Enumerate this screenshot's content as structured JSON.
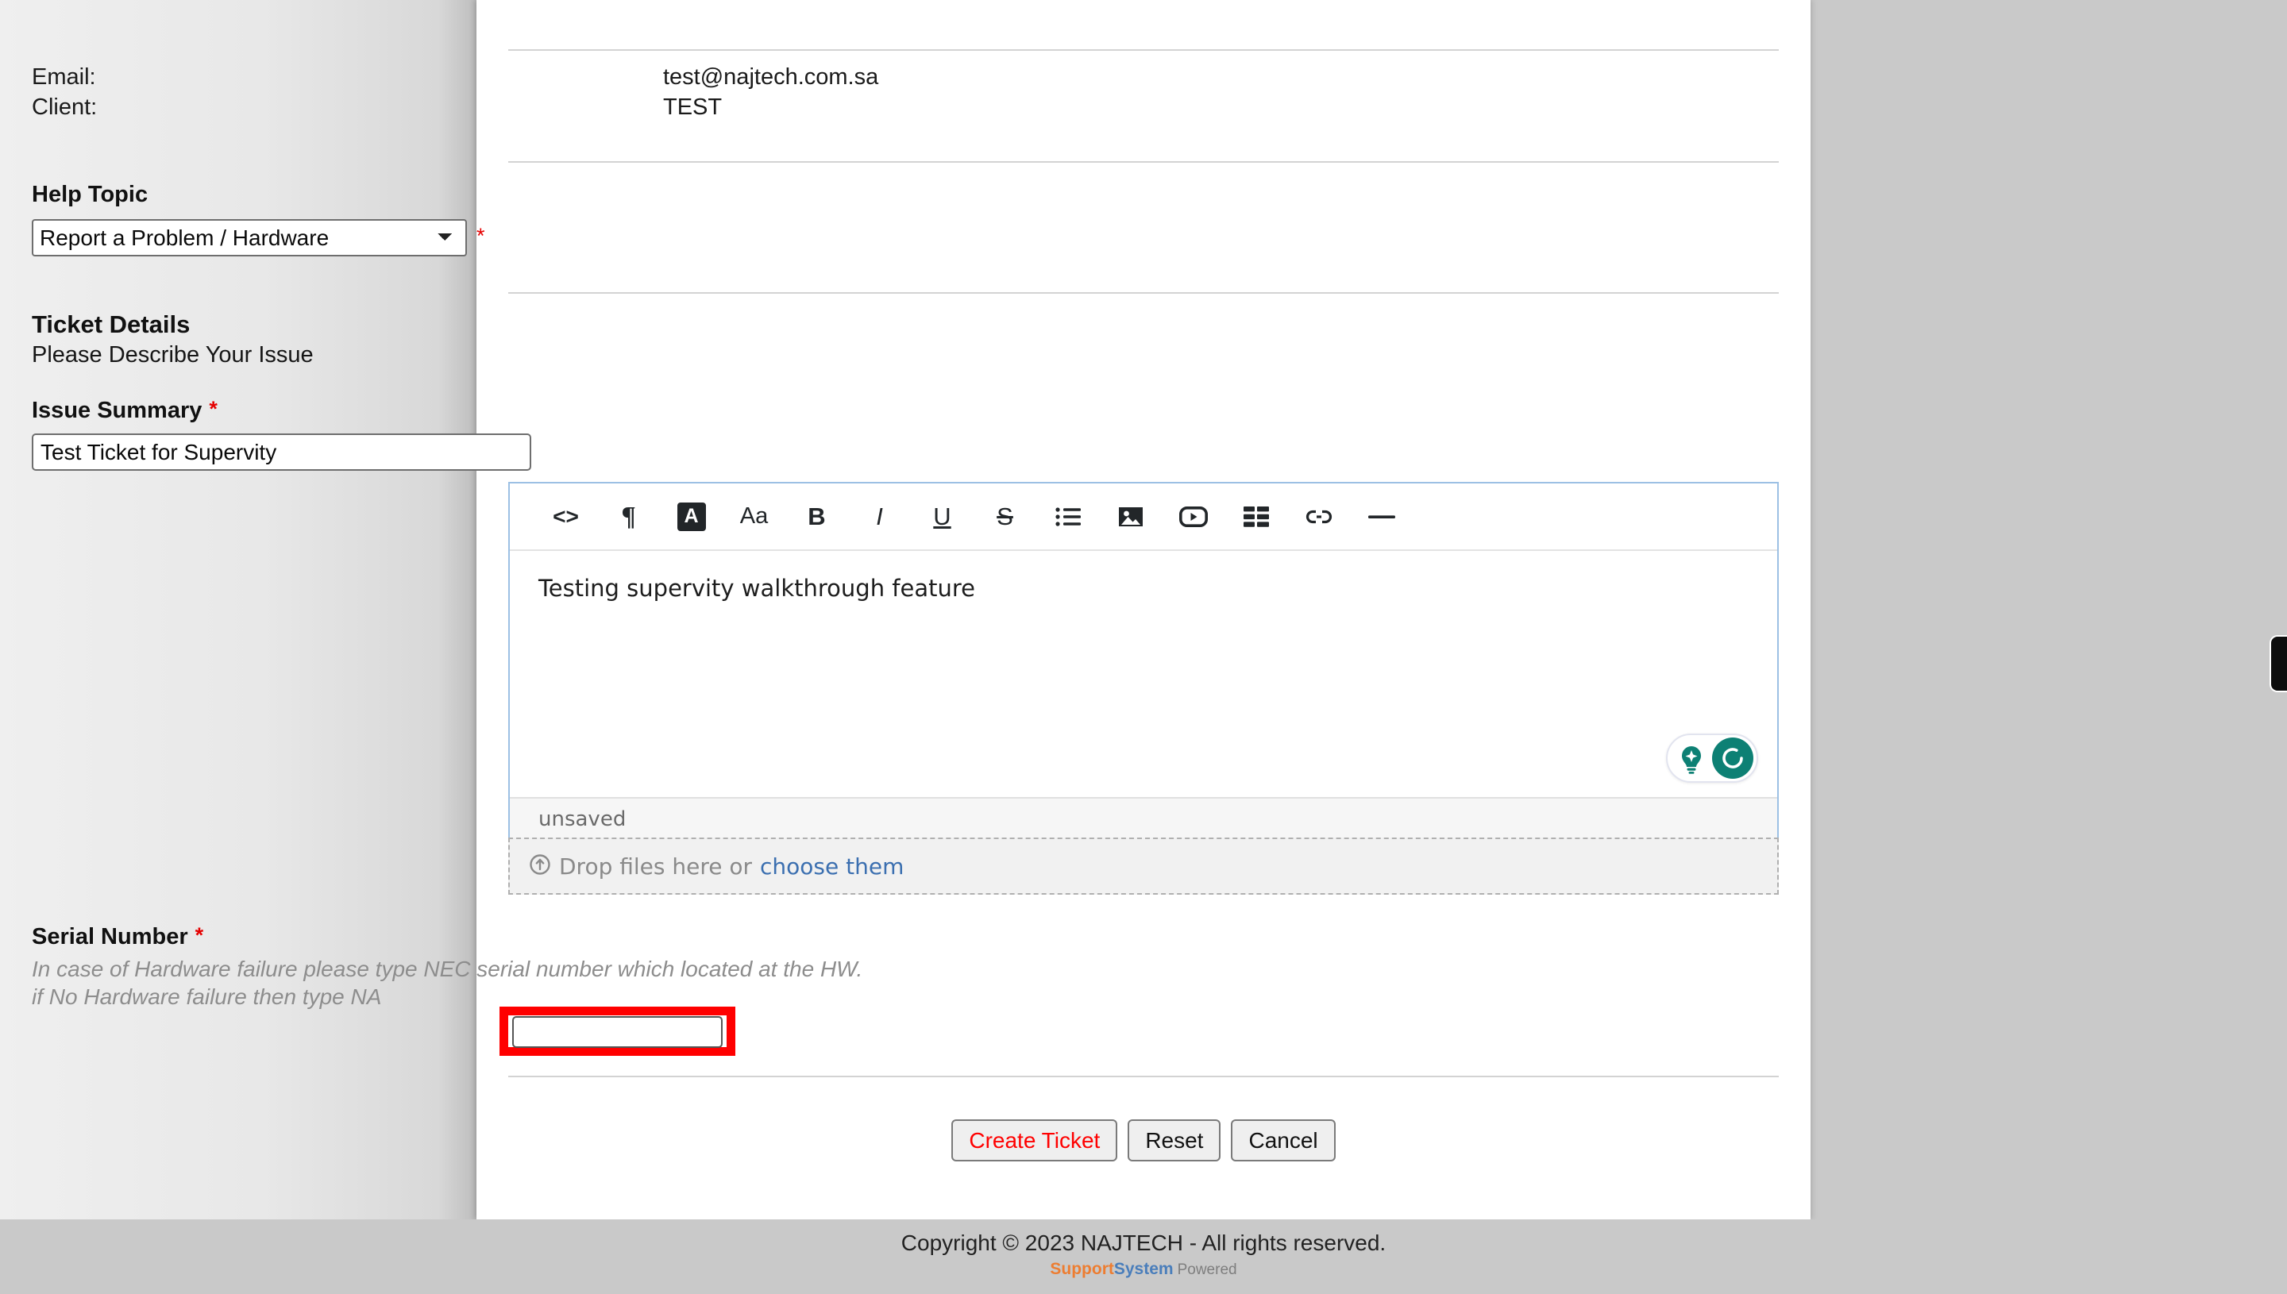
{
  "user_info": {
    "email_label": "Email:",
    "email_value": "test@najtech.com.sa",
    "client_label": "Client:",
    "client_value": "TEST"
  },
  "help_topic": {
    "heading": "Help Topic",
    "selected": "Report a Problem / Hardware",
    "options": [
      "Report a Problem / Hardware"
    ],
    "required_marker": "*"
  },
  "ticket_details": {
    "title": "Ticket Details",
    "subtitle": "Please Describe Your Issue"
  },
  "issue_summary": {
    "label": "Issue Summary",
    "required_marker": "*",
    "value": "Test Ticket for Supervity",
    "placeholder": ""
  },
  "editor": {
    "toolbar": [
      {
        "name": "code-icon",
        "glyph": "<>"
      },
      {
        "name": "paragraph-icon",
        "glyph": "¶"
      },
      {
        "name": "text-color-icon",
        "glyph": "A"
      },
      {
        "name": "font-size-icon",
        "glyph": "Aa"
      },
      {
        "name": "bold-icon",
        "glyph": "B"
      },
      {
        "name": "italic-icon",
        "glyph": "I"
      },
      {
        "name": "underline-icon",
        "glyph": "U"
      },
      {
        "name": "strikethrough-icon",
        "glyph": "S"
      },
      {
        "name": "bullet-list-icon",
        "glyph": "list"
      },
      {
        "name": "image-icon",
        "glyph": "image"
      },
      {
        "name": "video-icon",
        "glyph": "video"
      },
      {
        "name": "table-icon",
        "glyph": "table"
      },
      {
        "name": "link-icon",
        "glyph": "link"
      },
      {
        "name": "horizontal-rule-icon",
        "glyph": "—"
      }
    ],
    "body_text": "Testing supervity walkthrough feature",
    "status": "unsaved",
    "assistant_widget": {
      "name": "grammarly-widget"
    }
  },
  "dropzone": {
    "text": "Drop files here or",
    "link": "choose them",
    "icon": "upload-circle-icon"
  },
  "serial_number": {
    "label": "Serial Number",
    "required_marker": "*",
    "help_line_1": "In case of Hardware failure please type NEC serial number which located at the HW.",
    "help_line_2": "if No Hardware failure then type NA",
    "value": "",
    "placeholder": "",
    "highlight_color": "#ff0000"
  },
  "actions": {
    "create": "Create Ticket",
    "reset": "Reset",
    "cancel": "Cancel",
    "create_color": "#ff0000"
  },
  "footer": {
    "copyright": "Copyright © 2023 NAJTECH - All rights reserved.",
    "brand_support": "Support",
    "brand_system": "System",
    "brand_powered": "Powered",
    "support_color": "#ed7d31",
    "system_color": "#4a7ebb"
  }
}
